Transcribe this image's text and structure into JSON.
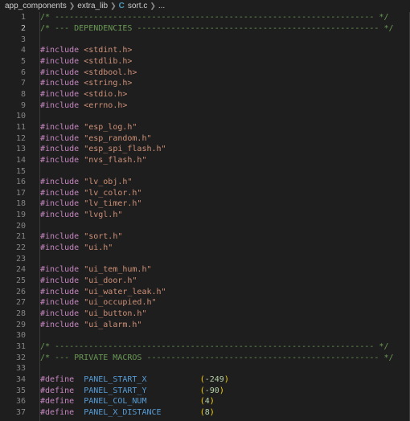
{
  "breadcrumb": {
    "items": [
      "app_components",
      "extra_lib",
      "sort.c",
      "..."
    ],
    "file_icon": "C"
  },
  "active_line": 2,
  "lines": [
    {
      "n": "1",
      "t": [
        [
          "cm",
          "/* ------------------------------------------------------------------ */"
        ]
      ]
    },
    {
      "n": "2",
      "t": [
        [
          "cm",
          "/* --- DEPENDENCIES -------------------------------------------------- */"
        ]
      ]
    },
    {
      "n": "3",
      "t": []
    },
    {
      "n": "4",
      "t": [
        [
          "kw",
          "#include"
        ],
        [
          "code",
          " "
        ],
        [
          "str",
          "<stdint.h>"
        ]
      ]
    },
    {
      "n": "5",
      "t": [
        [
          "kw",
          "#include"
        ],
        [
          "code",
          " "
        ],
        [
          "str",
          "<stdlib.h>"
        ]
      ]
    },
    {
      "n": "6",
      "t": [
        [
          "kw",
          "#include"
        ],
        [
          "code",
          " "
        ],
        [
          "str",
          "<stdbool.h>"
        ]
      ]
    },
    {
      "n": "7",
      "t": [
        [
          "kw",
          "#include"
        ],
        [
          "code",
          " "
        ],
        [
          "str",
          "<string.h>"
        ]
      ]
    },
    {
      "n": "8",
      "t": [
        [
          "kw",
          "#include"
        ],
        [
          "code",
          " "
        ],
        [
          "str",
          "<stdio.h>"
        ]
      ]
    },
    {
      "n": "9",
      "t": [
        [
          "kw",
          "#include"
        ],
        [
          "code",
          " "
        ],
        [
          "str",
          "<errno.h>"
        ]
      ]
    },
    {
      "n": "10",
      "t": []
    },
    {
      "n": "11",
      "t": [
        [
          "kw",
          "#include"
        ],
        [
          "code",
          " "
        ],
        [
          "str",
          "\"esp_log.h\""
        ]
      ]
    },
    {
      "n": "12",
      "t": [
        [
          "kw",
          "#include"
        ],
        [
          "code",
          " "
        ],
        [
          "str",
          "\"esp_random.h\""
        ]
      ]
    },
    {
      "n": "13",
      "t": [
        [
          "kw",
          "#include"
        ],
        [
          "code",
          " "
        ],
        [
          "str",
          "\"esp_spi_flash.h\""
        ]
      ]
    },
    {
      "n": "14",
      "t": [
        [
          "kw",
          "#include"
        ],
        [
          "code",
          " "
        ],
        [
          "str",
          "\"nvs_flash.h\""
        ]
      ]
    },
    {
      "n": "15",
      "t": []
    },
    {
      "n": "16",
      "t": [
        [
          "kw",
          "#include"
        ],
        [
          "code",
          " "
        ],
        [
          "str",
          "\"lv_obj.h\""
        ]
      ]
    },
    {
      "n": "17",
      "t": [
        [
          "kw",
          "#include"
        ],
        [
          "code",
          " "
        ],
        [
          "str",
          "\"lv_color.h\""
        ]
      ]
    },
    {
      "n": "18",
      "t": [
        [
          "kw",
          "#include"
        ],
        [
          "code",
          " "
        ],
        [
          "str",
          "\"lv_timer.h\""
        ]
      ]
    },
    {
      "n": "19",
      "t": [
        [
          "kw",
          "#include"
        ],
        [
          "code",
          " "
        ],
        [
          "str",
          "\"lvgl.h\""
        ]
      ]
    },
    {
      "n": "20",
      "t": []
    },
    {
      "n": "21",
      "t": [
        [
          "kw",
          "#include"
        ],
        [
          "code",
          " "
        ],
        [
          "str",
          "\"sort.h\""
        ]
      ]
    },
    {
      "n": "22",
      "t": [
        [
          "kw",
          "#include"
        ],
        [
          "code",
          " "
        ],
        [
          "str",
          "\"ui.h\""
        ]
      ]
    },
    {
      "n": "23",
      "t": []
    },
    {
      "n": "24",
      "t": [
        [
          "kw",
          "#include"
        ],
        [
          "code",
          " "
        ],
        [
          "str",
          "\"ui_tem_hum.h\""
        ]
      ]
    },
    {
      "n": "25",
      "t": [
        [
          "kw",
          "#include"
        ],
        [
          "code",
          " "
        ],
        [
          "str",
          "\"ui_door.h\""
        ]
      ]
    },
    {
      "n": "26",
      "t": [
        [
          "kw",
          "#include"
        ],
        [
          "code",
          " "
        ],
        [
          "str",
          "\"ui_water_leak.h\""
        ]
      ]
    },
    {
      "n": "27",
      "t": [
        [
          "kw",
          "#include"
        ],
        [
          "code",
          " "
        ],
        [
          "str",
          "\"ui_occupied.h\""
        ]
      ]
    },
    {
      "n": "28",
      "t": [
        [
          "kw",
          "#include"
        ],
        [
          "code",
          " "
        ],
        [
          "str",
          "\"ui_button.h\""
        ]
      ]
    },
    {
      "n": "29",
      "t": [
        [
          "kw",
          "#include"
        ],
        [
          "code",
          " "
        ],
        [
          "str",
          "\"ui_alarm.h\""
        ]
      ]
    },
    {
      "n": "30",
      "t": []
    },
    {
      "n": "31",
      "t": [
        [
          "cm",
          "/* ------------------------------------------------------------------ */"
        ]
      ]
    },
    {
      "n": "32",
      "t": [
        [
          "cm",
          "/* --- PRIVATE MACROS ------------------------------------------------ */"
        ]
      ]
    },
    {
      "n": "33",
      "t": []
    },
    {
      "n": "34",
      "t": [
        [
          "kw",
          "#define"
        ],
        [
          "code",
          "  "
        ],
        [
          "mac",
          "PANEL_START_X"
        ],
        [
          "code",
          "           "
        ],
        [
          "par",
          "("
        ],
        [
          "num",
          "-249"
        ],
        [
          "par",
          ")"
        ]
      ]
    },
    {
      "n": "35",
      "t": [
        [
          "kw",
          "#define"
        ],
        [
          "code",
          "  "
        ],
        [
          "mac",
          "PANEL_START_Y"
        ],
        [
          "code",
          "           "
        ],
        [
          "par",
          "("
        ],
        [
          "num",
          "-90"
        ],
        [
          "par",
          ")"
        ]
      ]
    },
    {
      "n": "36",
      "t": [
        [
          "kw",
          "#define"
        ],
        [
          "code",
          "  "
        ],
        [
          "mac",
          "PANEL_COL_NUM"
        ],
        [
          "code",
          "           "
        ],
        [
          "par",
          "("
        ],
        [
          "num",
          "4"
        ],
        [
          "par",
          ")"
        ]
      ]
    },
    {
      "n": "37",
      "t": [
        [
          "kw",
          "#define"
        ],
        [
          "code",
          "  "
        ],
        [
          "mac",
          "PANEL_X_DISTANCE"
        ],
        [
          "code",
          "        "
        ],
        [
          "par",
          "("
        ],
        [
          "num",
          "8"
        ],
        [
          "par",
          ")"
        ]
      ]
    }
  ]
}
